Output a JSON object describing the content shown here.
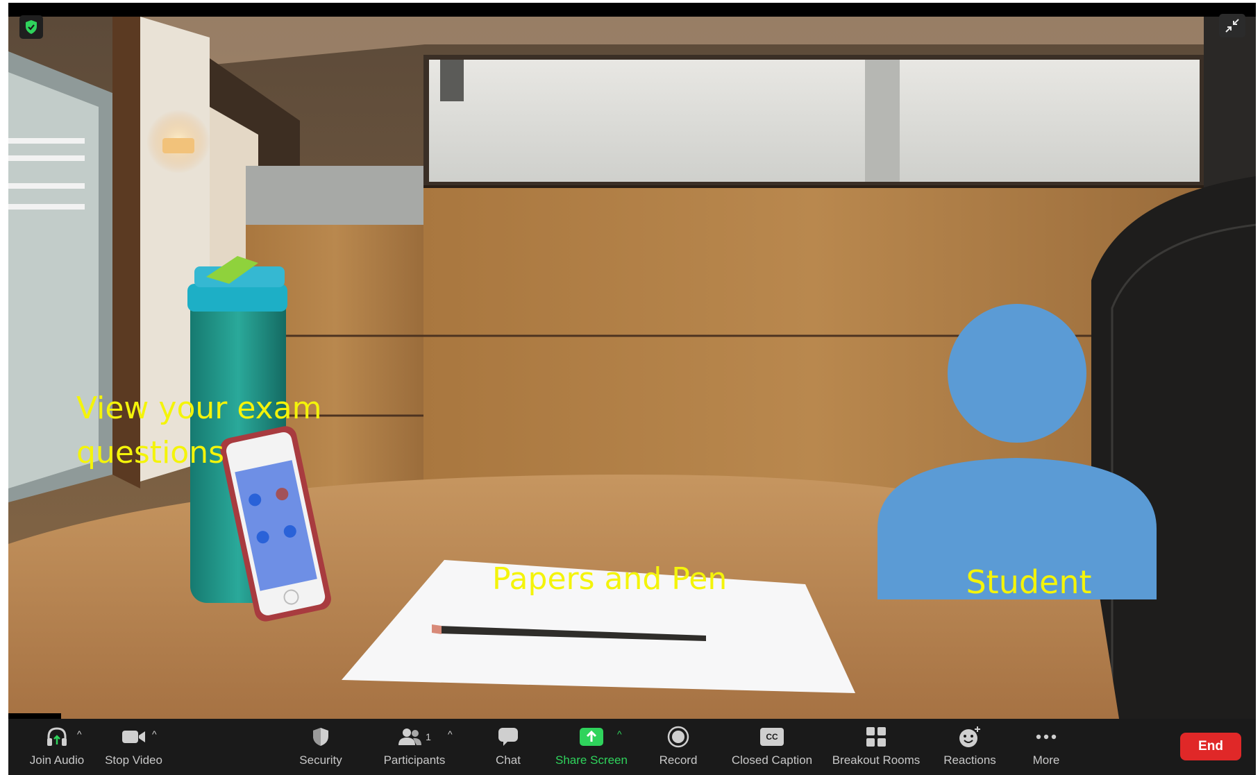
{
  "overlay": {
    "exam_label": "View your exam questions",
    "papers_label": "Papers and Pen",
    "student_label": "Student"
  },
  "toolbar": {
    "join_audio": "Join Audio",
    "stop_video": "Stop Video",
    "security": "Security",
    "participants": "Participants",
    "participant_count": "1",
    "chat": "Chat",
    "share_screen": "Share Screen",
    "record": "Record",
    "closed_caption": "Closed Caption",
    "closed_caption_icon_text": "CC",
    "breakout_rooms": "Breakout Rooms",
    "reactions": "Reactions",
    "more": "More",
    "end": "End"
  },
  "icons": {
    "join_audio": "headphones-icon",
    "stop_video": "video-camera-icon",
    "security": "shield-icon",
    "participants": "people-icon",
    "chat": "speech-bubble-icon",
    "share_screen": "share-arrow-icon",
    "record": "record-circle-icon",
    "closed_caption": "cc-icon",
    "breakout_rooms": "grid-icon",
    "reactions": "smiley-icon",
    "more": "ellipsis-icon",
    "encryption": "green-shield-icon",
    "exit_fullscreen": "exit-fullscreen-icon"
  },
  "colors": {
    "toolbar_bg": "#1a1a1a",
    "share_green": "#2fd35c",
    "end_red": "#e02828",
    "overlay_yellow": "#f4f40a",
    "student_blue": "#5b9bd5"
  }
}
